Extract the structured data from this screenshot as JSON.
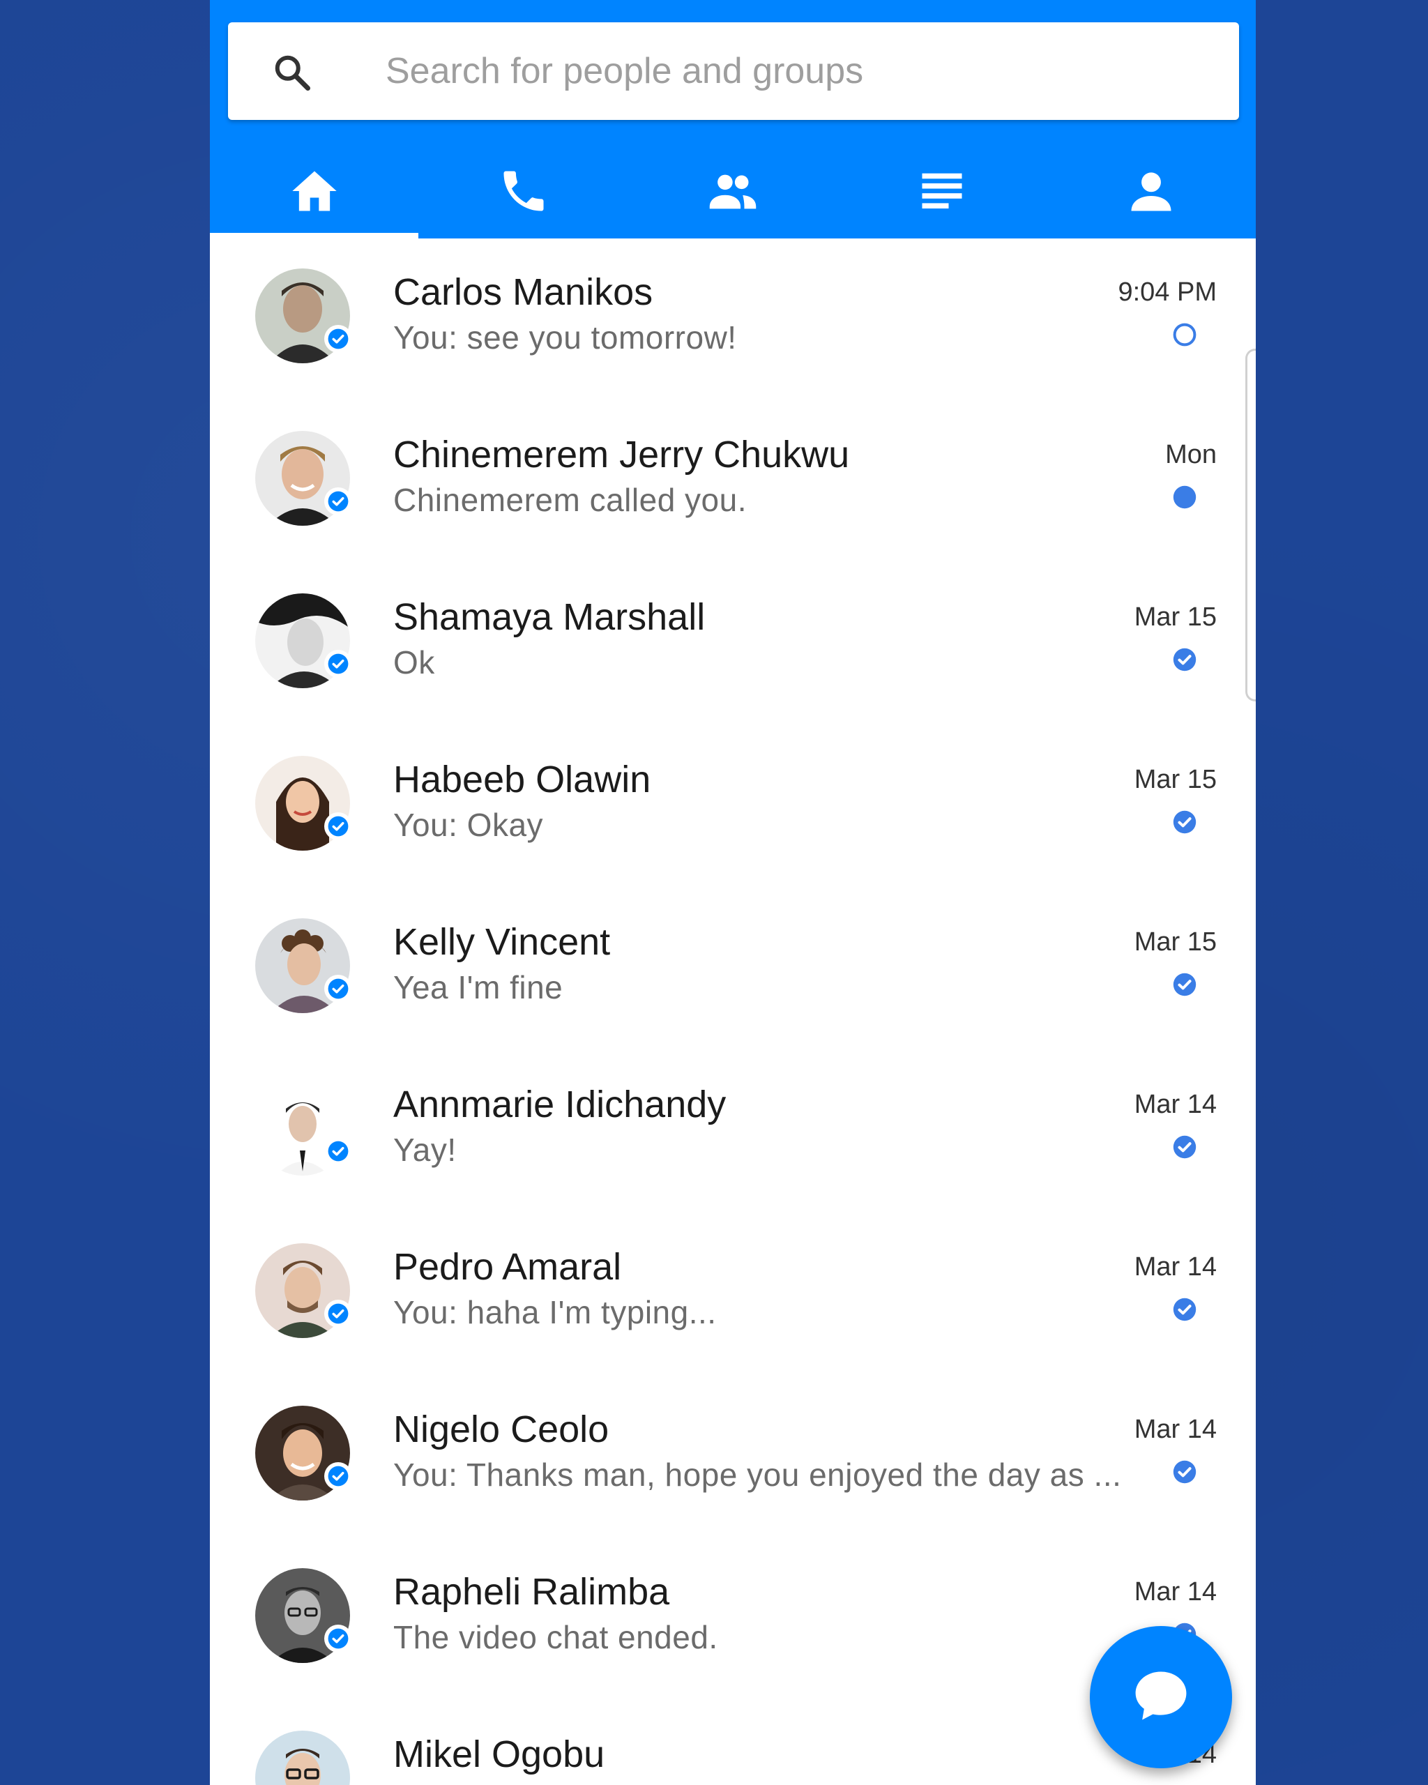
{
  "search": {
    "placeholder": "Search for people and groups",
    "icon": "search-icon"
  },
  "tabs": [
    {
      "name": "home",
      "icon": "home-icon",
      "active": true
    },
    {
      "name": "calls",
      "icon": "phone-icon",
      "active": false
    },
    {
      "name": "groups",
      "icon": "people-icon",
      "active": false
    },
    {
      "name": "stories",
      "icon": "list-icon",
      "active": false
    },
    {
      "name": "profile",
      "icon": "person-icon",
      "active": false
    }
  ],
  "colors": {
    "brand": "#0084ff",
    "background": "#1d4596",
    "status_dot": "#3a7de6"
  },
  "conversations": [
    {
      "name": "Carlos Manikos",
      "preview": "You: see you tomorrow!",
      "time": "9:04 PM",
      "status": "sent-ring"
    },
    {
      "name": "Chinemerem Jerry Chukwu",
      "preview": "Chinemerem called you.",
      "time": "Mon",
      "status": "unread-dot"
    },
    {
      "name": "Shamaya Marshall",
      "preview": "Ok",
      "time": "Mar 15",
      "status": "delivered-check"
    },
    {
      "name": "Habeeb Olawin",
      "preview": "You: Okay",
      "time": "Mar 15",
      "status": "delivered-check"
    },
    {
      "name": "Kelly Vincent",
      "preview": "Yea I'm fine",
      "time": "Mar 15",
      "status": "delivered-check"
    },
    {
      "name": "Annmarie Idichandy",
      "preview": "Yay!",
      "time": "Mar 14",
      "status": "delivered-check"
    },
    {
      "name": "Pedro Amaral",
      "preview": "You: haha I'm typing...",
      "time": "Mar 14",
      "status": "delivered-check"
    },
    {
      "name": "Nigelo Ceolo",
      "preview": "You: Thanks man, hope you enjoyed the day as ...",
      "time": "Mar 14",
      "status": "delivered-check"
    },
    {
      "name": "Rapheli Ralimba",
      "preview": "The video chat ended.",
      "time": "Mar 14",
      "status": "delivered-check"
    },
    {
      "name": "Mikel Ogobu",
      "preview": "",
      "time": "Mar 14",
      "status": "delivered-check"
    }
  ],
  "fab": {
    "icon": "new-message-icon"
  }
}
